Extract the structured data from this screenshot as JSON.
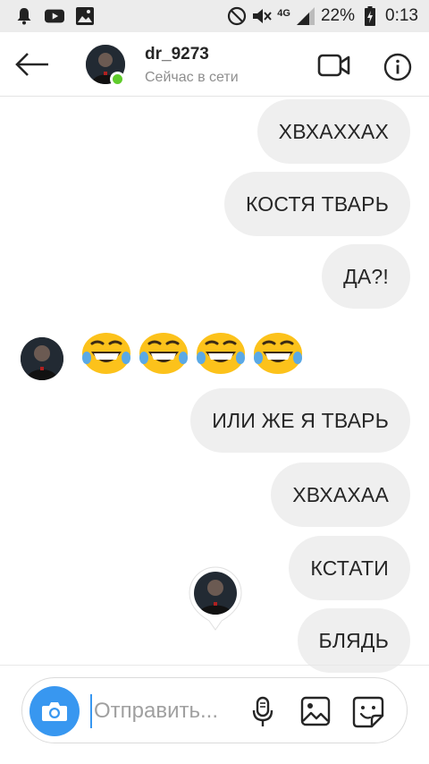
{
  "status_bar": {
    "network_type": "4G",
    "battery_percent": "22%",
    "time": "0:13",
    "left_icons": [
      "notification-bell-icon",
      "youtube-icon",
      "gallery-icon"
    ],
    "right_icons": [
      "dnd-icon",
      "mute-icon",
      "signal-icon",
      "battery-charging-icon"
    ]
  },
  "header": {
    "username": "dr_9273",
    "presence": "Сейчас в сети",
    "online": true,
    "online_color": "#5fcc2b"
  },
  "messages": [
    {
      "direction": "outgoing",
      "text": "ХВХАХХАХ"
    },
    {
      "direction": "outgoing",
      "text": "КОСТЯ ТВАРЬ"
    },
    {
      "direction": "outgoing",
      "text": "ДА?!"
    },
    {
      "direction": "incoming",
      "emoji": [
        "grinning-squinting-face",
        "grinning-squinting-face",
        "grinning-squinting-face",
        "grinning-squinting-face"
      ]
    },
    {
      "direction": "outgoing",
      "text": "ИЛИ ЖЕ Я ТВАРЬ"
    },
    {
      "direction": "outgoing",
      "text": "ХВХАХАА"
    },
    {
      "direction": "outgoing",
      "text": "КСТАТИ"
    },
    {
      "direction": "outgoing",
      "text": "БЛЯДЬ"
    }
  ],
  "composer": {
    "placeholder": "Отправить...",
    "value": "",
    "accent_color": "#3897f0"
  },
  "colors": {
    "bubble_bg": "#efefef",
    "status_bar_bg": "#ececec",
    "text": "#262626",
    "secondary_text": "#8e8e8e"
  }
}
